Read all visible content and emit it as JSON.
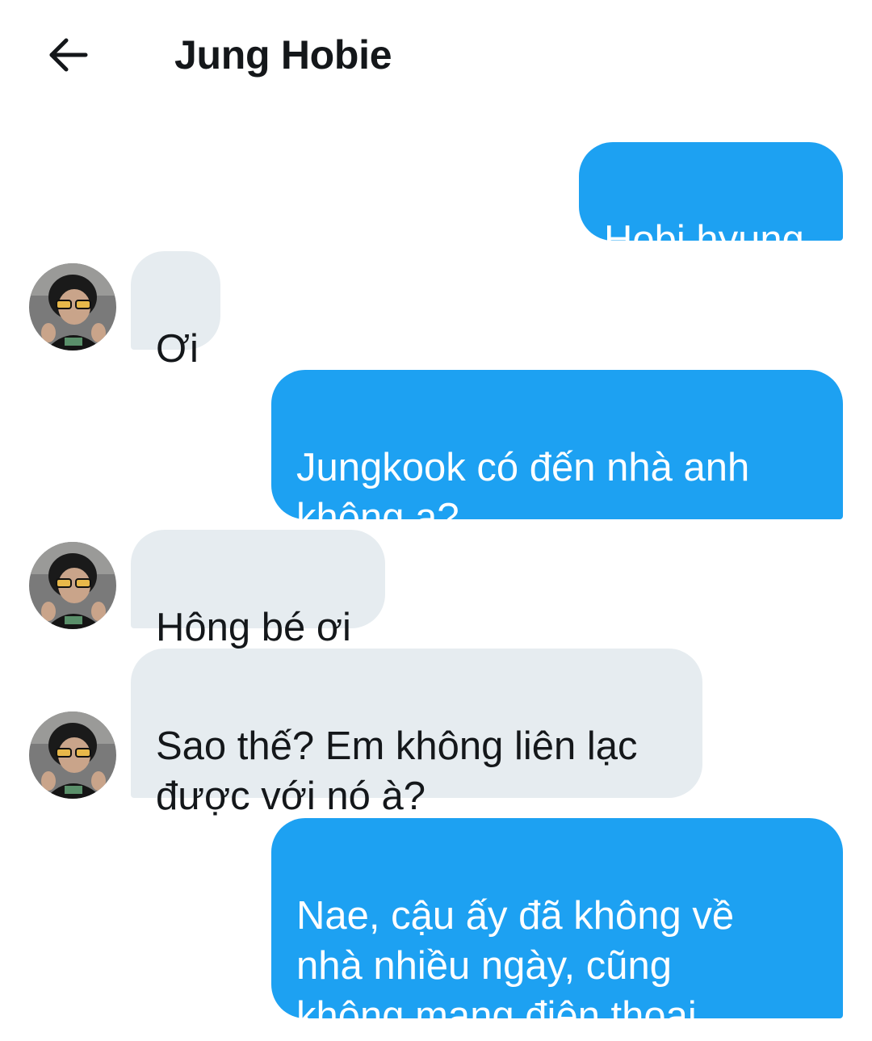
{
  "header": {
    "title": "Jung Hobie",
    "back_icon": "arrow-left-icon"
  },
  "contact": {
    "name": "Jung Hobie",
    "avatar_icon": "profile-photo"
  },
  "messages": [
    {
      "sender": "me",
      "text": "Hobi hyung"
    },
    {
      "sender": "them",
      "text": "Ơi"
    },
    {
      "sender": "me",
      "text": "Jungkook có đến nhà anh\nkhông ạ?"
    },
    {
      "sender": "them",
      "text": "Hông bé ơi"
    },
    {
      "sender": "them",
      "text": "Sao thế? Em không liên lạc\nđược với nó à?"
    },
    {
      "sender": "me",
      "text": "Nae, cậu ấy đã không về\nnhà nhiều ngày, cũng\nkhông mang điện thoại"
    }
  ],
  "colors": {
    "sent_bubble": "#1da1f2",
    "received_bubble": "#e6ecf0",
    "text": "#14171a"
  }
}
